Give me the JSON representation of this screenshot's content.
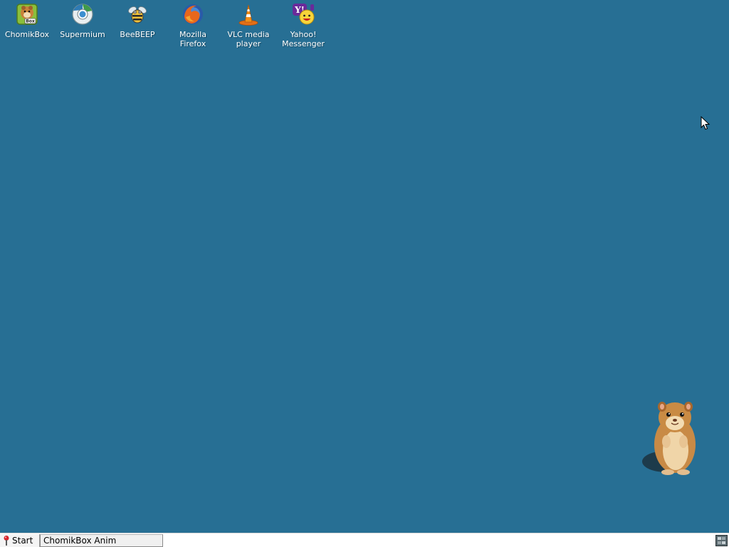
{
  "desktop": {
    "background_color": "#276f94",
    "icons": [
      {
        "label": "ChomikBox",
        "icon": "chomikbox-icon"
      },
      {
        "label": "Supermium",
        "icon": "supermium-icon"
      },
      {
        "label": "BeeBEEP",
        "icon": "beebeep-icon"
      },
      {
        "label": "Mozilla\nFirefox",
        "icon": "firefox-icon"
      },
      {
        "label": "VLC media\nplayer",
        "icon": "vlc-icon"
      },
      {
        "label": "Yahoo!\nMessenger",
        "icon": "yahoo-messenger-icon"
      }
    ],
    "overlay": {
      "icon": "hamster-icon"
    },
    "cursor": {
      "icon": "mouse-cursor-icon"
    }
  },
  "taskbar": {
    "start_label": "Start",
    "start_icon": "start-icon",
    "tasks": [
      {
        "label": "ChomikBox Anim",
        "active": true
      }
    ],
    "tray_icon": "system-tray-icon"
  }
}
